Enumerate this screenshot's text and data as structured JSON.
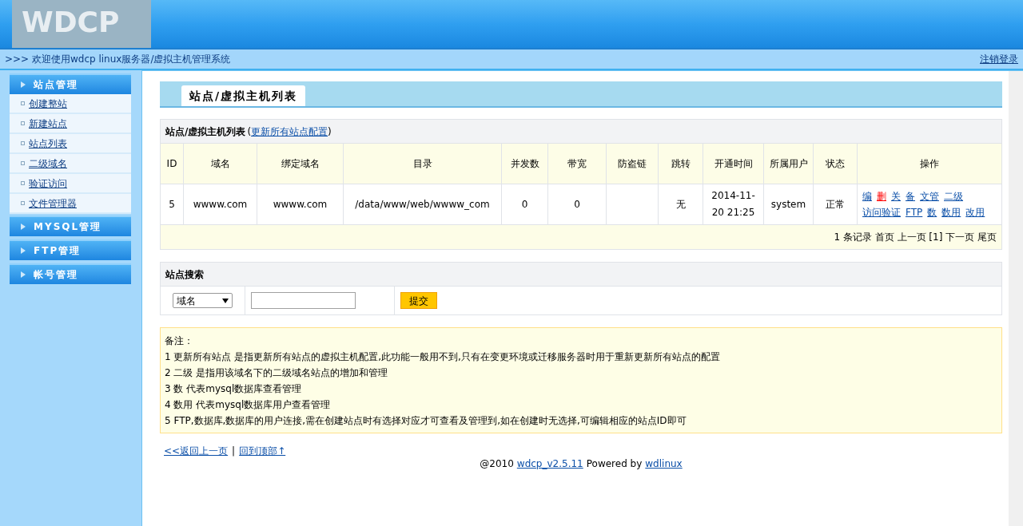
{
  "header": {
    "logo": "WDCP"
  },
  "top_bar": {
    "welcome": ">>> 欢迎使用wdcp linux服务器/虚拟主机管理系统",
    "logout": "注销登录"
  },
  "sidebar": {
    "groups": [
      {
        "title": "站点管理",
        "items": [
          "创建整站",
          "新建站点",
          "站点列表",
          "二级域名",
          "验证访问",
          "文件管理器"
        ]
      },
      {
        "title": "MYSQL管理"
      },
      {
        "title": "FTP管理"
      },
      {
        "title": "帐号管理"
      }
    ]
  },
  "page_tab": "站点/虚拟主机列表",
  "table": {
    "title": "站点/虚拟主机列表",
    "title_open": "(",
    "title_link": "更新所有站点配置",
    "title_close": ")",
    "columns": [
      "ID",
      "域名",
      "绑定域名",
      "目录",
      "并发数",
      "带宽",
      "防盗链",
      "跳转",
      "开通时间",
      "所属用户",
      "状态",
      "操作"
    ],
    "rows": [
      {
        "cells": [
          "5",
          "wwww.com",
          "wwww.com",
          "/data/www/web/wwww_com",
          "0",
          "0",
          "",
          "无",
          "2014-11-20 21:25",
          "system",
          "正常"
        ],
        "actions": [
          {
            "label": "编",
            "color": "#0b4fa8"
          },
          {
            "label": "删",
            "color": "#ff0000"
          },
          {
            "label": "关",
            "color": "#0b4fa8"
          },
          {
            "label": "备",
            "color": "#0b4fa8"
          },
          {
            "label": "文管",
            "color": "#0b4fa8"
          },
          {
            "label": "二级",
            "color": "#0b4fa8"
          },
          {
            "label": "访问验证",
            "color": "#0b4fa8"
          },
          {
            "label": "FTP",
            "color": "#0b4fa8"
          },
          {
            "label": "数",
            "color": "#0b4fa8"
          },
          {
            "label": "数用",
            "color": "#0b4fa8"
          },
          {
            "label": "改用",
            "color": "#0b4fa8"
          }
        ]
      }
    ],
    "pagination": "1 条记录 首页 上一页 [1] 下一页 尾页"
  },
  "search": {
    "title": "站点搜索",
    "select": "域名",
    "submit": "提交"
  },
  "notes": {
    "title": "备注：",
    "lines": [
      "1 更新所有站点 是指更新所有站点的虚拟主机配置,此功能一般用不到,只有在变更环境或迁移服务器时用于重新更新所有站点的配置",
      "2 二级 是指用该域名下的二级域名站点的增加和管理",
      "3 数 代表mysql数据库查看管理",
      "4 数用 代表mysql数据库用户查看管理",
      "5 FTP,数据库,数据库的用户连接,需在创建站点时有选择对应才可查看及管理到,如在创建时无选择,可编辑相应的站点ID即可"
    ]
  },
  "footer": {
    "back": "<<返回上一页",
    "separator": "|",
    "top": "回到顶部↑",
    "copyright": "@2010",
    "version": "wdcp_v2.5.11",
    "powered": "Powered by",
    "powered_link": "wdlinux"
  }
}
